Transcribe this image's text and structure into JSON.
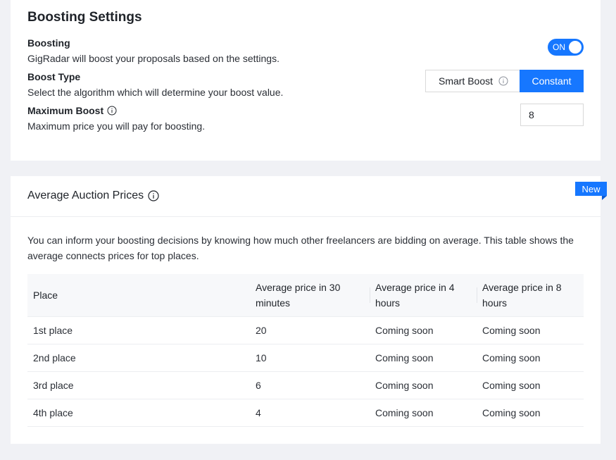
{
  "boosting_settings": {
    "title": "Boosting Settings",
    "boosting": {
      "label": "Boosting",
      "description": "GigRadar will boost your proposals based on the settings.",
      "toggle_text": "ON",
      "toggle_on": true
    },
    "boost_type": {
      "label": "Boost Type",
      "description": "Select the algorithm which will determine your boost value.",
      "options": [
        "Smart Boost",
        "Constant"
      ],
      "selected": "Constant"
    },
    "maximum_boost": {
      "label": "Maximum Boost",
      "description": "Maximum price you will pay for boosting.",
      "value": "8"
    }
  },
  "auction_prices": {
    "title": "Average Auction Prices",
    "badge": "New",
    "intro": "You can inform your boosting decisions by knowing how much other freelancers are bidding on average. This table shows the average connects prices for top places.",
    "columns": [
      "Place",
      "Average price in 30 minutes",
      "Average price in 4 hours",
      "Average price in 8 hours"
    ],
    "rows": [
      [
        "1st place",
        "20",
        "Coming soon",
        "Coming soon"
      ],
      [
        "2nd place",
        "10",
        "Coming soon",
        "Coming soon"
      ],
      [
        "3rd place",
        "6",
        "Coming soon",
        "Coming soon"
      ],
      [
        "4th place",
        "4",
        "Coming soon",
        "Coming soon"
      ]
    ]
  },
  "colors": {
    "accent": "#1677ff",
    "background": "#f0f1f5",
    "card": "#ffffff"
  },
  "icons": [
    "info-icon"
  ]
}
